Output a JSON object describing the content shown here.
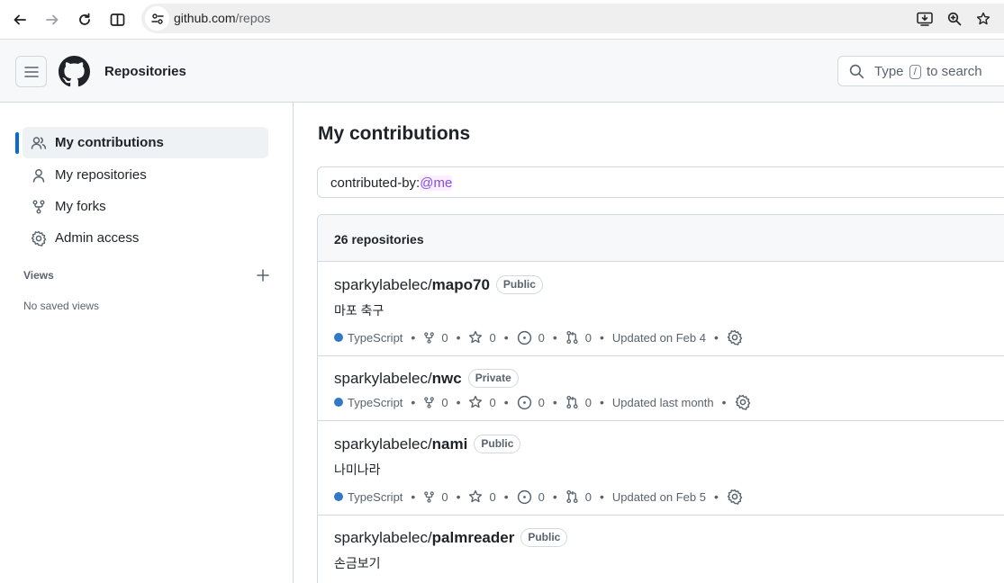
{
  "browser": {
    "url_host": "github.com",
    "url_path": "/repos"
  },
  "header": {
    "title": "Repositories",
    "search_prefix": "Type",
    "search_key": "/",
    "search_suffix": "to search"
  },
  "sidebar": {
    "items": [
      {
        "label": "My contributions",
        "icon": "people-icon",
        "active": true
      },
      {
        "label": "My repositories",
        "icon": "person-icon",
        "active": false
      },
      {
        "label": "My forks",
        "icon": "fork-icon",
        "active": false
      },
      {
        "label": "Admin access",
        "icon": "gear-icon",
        "active": false
      }
    ],
    "views_label": "Views",
    "no_views": "No saved views"
  },
  "main": {
    "title": "My contributions",
    "filter_prefix": "contributed-by:",
    "filter_value": "@me",
    "count_label": "26 repositories"
  },
  "repos": [
    {
      "owner": "sparkylabelec/",
      "name": "mapo70",
      "visibility": "Public",
      "description": "마포 축구",
      "language": "TypeScript",
      "forks": "0",
      "stars": "0",
      "issues": "0",
      "prs": "0",
      "updated": "Updated on Feb 4"
    },
    {
      "owner": "sparkylabelec/",
      "name": "nwc",
      "visibility": "Private",
      "description": "",
      "language": "TypeScript",
      "forks": "0",
      "stars": "0",
      "issues": "0",
      "prs": "0",
      "updated": "Updated last month"
    },
    {
      "owner": "sparkylabelec/",
      "name": "nami",
      "visibility": "Public",
      "description": "나미나라",
      "language": "TypeScript",
      "forks": "0",
      "stars": "0",
      "issues": "0",
      "prs": "0",
      "updated": "Updated on Feb 5"
    },
    {
      "owner": "sparkylabelec/",
      "name": "palmreader",
      "visibility": "Public",
      "description": "손금보기",
      "language": "",
      "forks": "",
      "stars": "",
      "issues": "",
      "prs": "",
      "updated": ""
    }
  ],
  "colors": {
    "accent": "#0969da",
    "typescript": "#3178c6",
    "me_token": "#8250df"
  }
}
